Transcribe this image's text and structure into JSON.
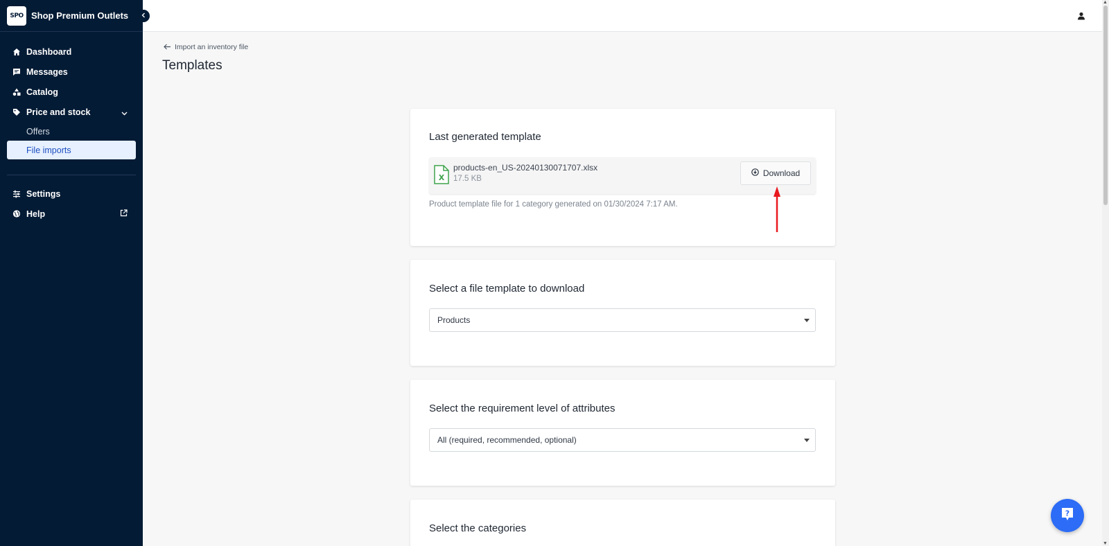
{
  "brand": {
    "logo_text": "SPO",
    "name": "Shop Premium Outlets"
  },
  "sidebar": {
    "items": [
      {
        "label": "Dashboard",
        "icon": "home-icon"
      },
      {
        "label": "Messages",
        "icon": "message-icon"
      },
      {
        "label": "Catalog",
        "icon": "shapes-icon"
      },
      {
        "label": "Price and stock",
        "icon": "tag-icon"
      }
    ],
    "sub_items": [
      {
        "label": "Offers"
      },
      {
        "label": "File imports",
        "active": true
      }
    ],
    "bottom_items": [
      {
        "label": "Settings",
        "icon": "sliders-icon"
      },
      {
        "label": "Help",
        "icon": "globe-icon"
      }
    ]
  },
  "main": {
    "back_link": "Import an inventory file",
    "title": "Templates",
    "last_generated": {
      "title": "Last generated template",
      "file_name": "products-en_US-20240130071707.xlsx",
      "file_size": "17.5 KB",
      "download_label": "Download",
      "description": "Product template file for 1 category generated on 01/30/2024 7:17 AM."
    },
    "file_template": {
      "title": "Select a file template to download",
      "selected": "Products"
    },
    "requirement_level": {
      "title": "Select the requirement level of attributes",
      "selected": "All (required, recommended, optional)"
    },
    "categories": {
      "title": "Select the categories"
    }
  },
  "colors": {
    "sidebar_bg": "#041b35",
    "active_bg": "#e6f0ff",
    "accent": "#2c6cf6",
    "annotation": "#e8191e"
  }
}
